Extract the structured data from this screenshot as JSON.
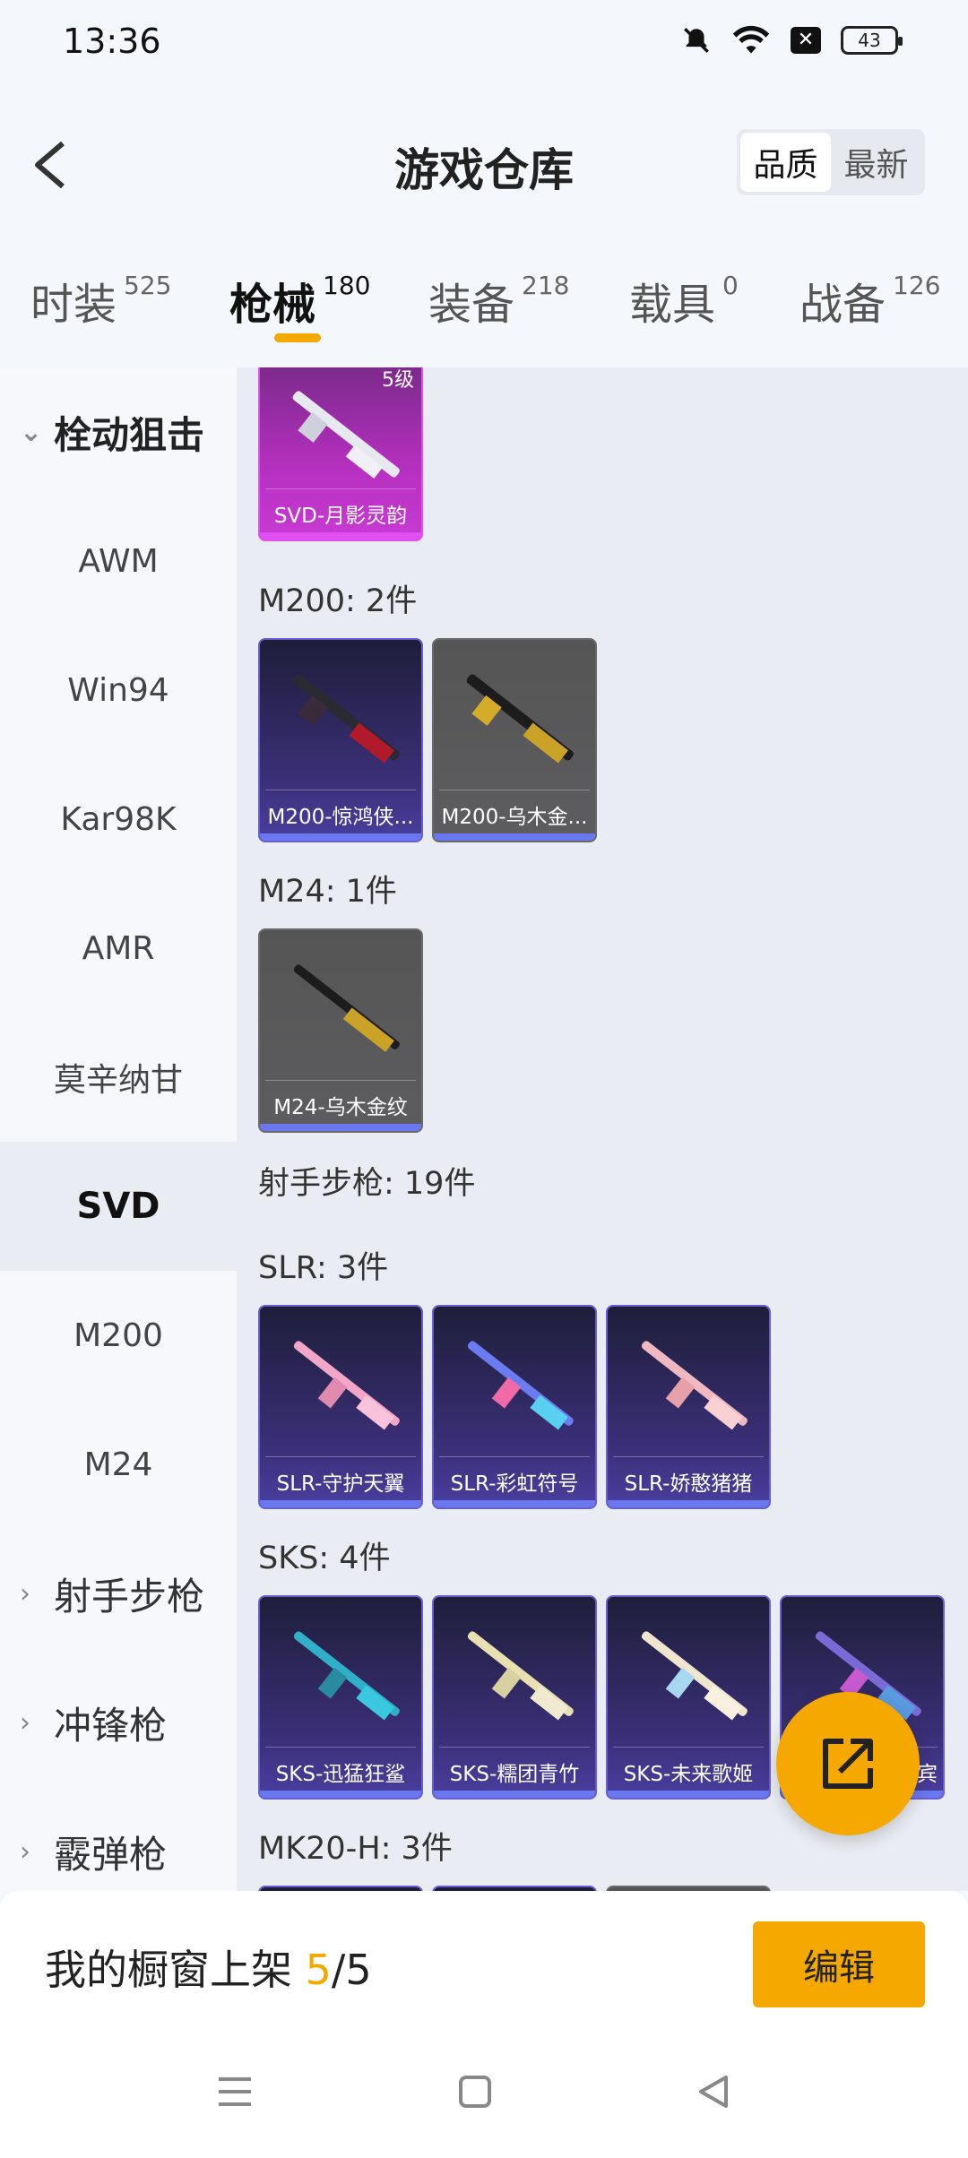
{
  "status_bar": {
    "time": "13:36",
    "battery": "43"
  },
  "header": {
    "title": "游戏仓库",
    "sort_options": [
      "品质",
      "最新"
    ]
  },
  "tabs": [
    {
      "label": "时装",
      "count": "525"
    },
    {
      "label": "枪械",
      "count": "180"
    },
    {
      "label": "装备",
      "count": "218"
    },
    {
      "label": "载具",
      "count": "0"
    },
    {
      "label": "战备",
      "count": "126"
    }
  ],
  "sidebar": {
    "items": [
      {
        "label": "栓动狙击"
      },
      {
        "label": "AWM"
      },
      {
        "label": "Win94"
      },
      {
        "label": "Kar98K"
      },
      {
        "label": "AMR"
      },
      {
        "label": "莫辛纳甘"
      },
      {
        "label": "SVD"
      },
      {
        "label": "M200"
      },
      {
        "label": "M24"
      },
      {
        "label": "射手步枪"
      },
      {
        "label": "冲锋枪"
      },
      {
        "label": "霰弹枪"
      }
    ]
  },
  "content": {
    "top_card": {
      "name": "SVD-月影灵韵",
      "level": "5级"
    },
    "sections": [
      {
        "title": "M200: 2件",
        "items": [
          "M200-惊鸿侠...",
          "M200-乌木金..."
        ]
      },
      {
        "title": "M24: 1件",
        "items": [
          "M24-乌木金纹"
        ]
      },
      {
        "title": "射手步枪: 19件"
      },
      {
        "title": "SLR: 3件",
        "items": [
          "SLR-守护天翼",
          "SLR-彩虹符号",
          "SLR-娇憨猪猪"
        ]
      },
      {
        "title": "SKS: 4件",
        "items": [
          "SKS-迅猛狂鲨",
          "SKS-糯团青竹",
          "SKS-未来歌姬",
          "宾"
        ]
      },
      {
        "title": "MK20-H: 3件"
      }
    ]
  },
  "bottom_bar": {
    "showcase_label": "我的橱窗上架 ",
    "showcase_current": "5",
    "showcase_total": "/5",
    "edit_label": "编辑"
  },
  "colors": {
    "accent": "#f5a800",
    "purple_card": "#3b2f78",
    "gray_card": "#5d5d60",
    "pink_card": "#b630c0"
  }
}
